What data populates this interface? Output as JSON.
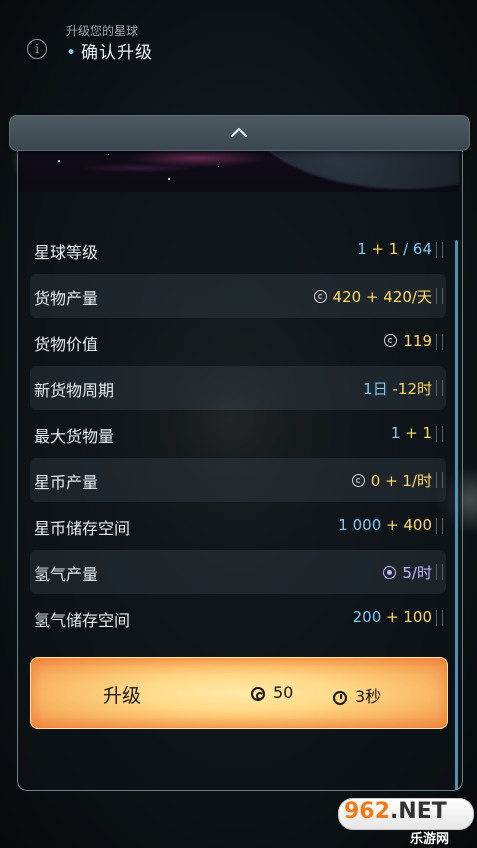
{
  "header": {
    "subtitle": "升级您的星球",
    "title": "确认升级",
    "title_bullet": "•",
    "info_icon": "i"
  },
  "collapse": {
    "icon": "chevron-up-icon"
  },
  "stats": [
    {
      "label": "星球等级",
      "base": "1",
      "add": "+ 1",
      "extra": " / 64",
      "icon": null
    },
    {
      "label": "货物产量",
      "base": "420",
      "add": "+ 420/天",
      "extra": "",
      "icon": "coin-icon"
    },
    {
      "label": "货物价值",
      "base": "119",
      "add": "",
      "extra": "",
      "icon": "coin-icon"
    },
    {
      "label": "新货物周期",
      "base": "1日",
      "add": "-12时",
      "extra": "",
      "icon": null
    },
    {
      "label": "最大货物量",
      "base": "1",
      "add": "+ 1",
      "extra": "",
      "icon": null
    },
    {
      "label": "星币产量",
      "base": "0",
      "add": "+ 1/时",
      "extra": "",
      "icon": "coin-icon"
    },
    {
      "label": "星币储存空间",
      "base": "1 000",
      "add": "+ 400",
      "extra": "",
      "icon": null
    },
    {
      "label": "氢气产量",
      "base": "5/时",
      "add": "",
      "extra": "",
      "icon": "hydrogen-icon"
    },
    {
      "label": "氢气储存空间",
      "base": "200",
      "add": "+ 100",
      "extra": "",
      "icon": null
    }
  ],
  "upgrade": {
    "label": "升级",
    "cost": "50",
    "time": "3秒"
  },
  "watermark": {
    "number": "962",
    "domain": ".NET",
    "sub": "乐游网"
  },
  "colors": {
    "base_value": "#7fc7f0",
    "added_value": "#ffd86a",
    "hydrogen": "#c9b5ff",
    "upgrade_button": "#ffd988"
  }
}
